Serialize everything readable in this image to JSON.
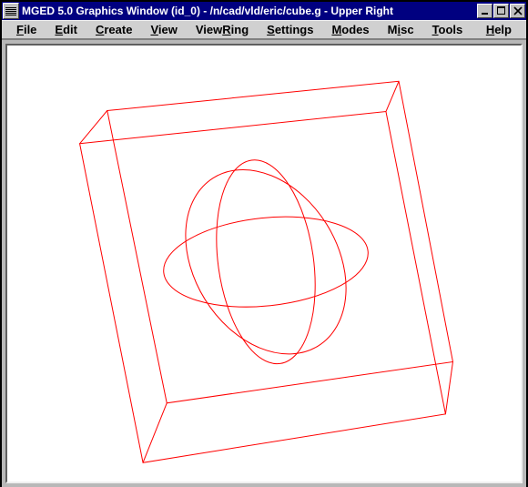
{
  "titlebar": {
    "app": "MGED 5.0 Graphics Window",
    "session": "(id_0)",
    "sep1": " - ",
    "path": "/n/cad/vld/eric/cube.g",
    "sep2": " - ",
    "view": "Upper Right"
  },
  "menus": {
    "file": "File",
    "edit": "Edit",
    "create": "Create",
    "view": "View",
    "viewring": "ViewRing",
    "settings": "Settings",
    "modes": "Modes",
    "misc": "Misc",
    "tools": "Tools",
    "help": "Help"
  },
  "wireframe": {
    "color": "#ff0000"
  }
}
